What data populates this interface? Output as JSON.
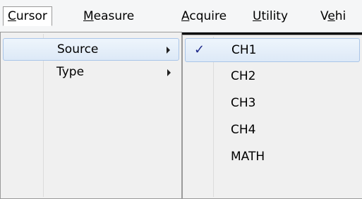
{
  "menubar": {
    "items": [
      {
        "label": "Cursor",
        "mnemonic": "C",
        "rest": "ursor"
      },
      {
        "label": "Measure",
        "mnemonic": "M",
        "rest": "easure"
      },
      {
        "label": "Acquire",
        "mnemonic": "A",
        "rest": "cquire"
      },
      {
        "label": "Utility",
        "mnemonic": "U",
        "rest": "tility"
      },
      {
        "label": "Vehi",
        "pre": "V",
        "mnemonic": "e",
        "rest": "hi"
      }
    ]
  },
  "cursor_menu": {
    "items": [
      {
        "label": "Source",
        "has_submenu": true,
        "highlighted": true
      },
      {
        "label": "Type",
        "has_submenu": true
      }
    ]
  },
  "source_submenu": {
    "check_glyph": "✓",
    "items": [
      {
        "label": "CH1",
        "checked": true,
        "highlighted": true
      },
      {
        "label": "CH2"
      },
      {
        "label": "CH3"
      },
      {
        "label": "CH4"
      },
      {
        "label": "MATH"
      }
    ]
  },
  "colors": {
    "menubar_bg": "#f5f6f7",
    "menu_bg": "#f0f0f0",
    "highlight_border": "#a9c5e8",
    "check": "#1f2a8a"
  }
}
